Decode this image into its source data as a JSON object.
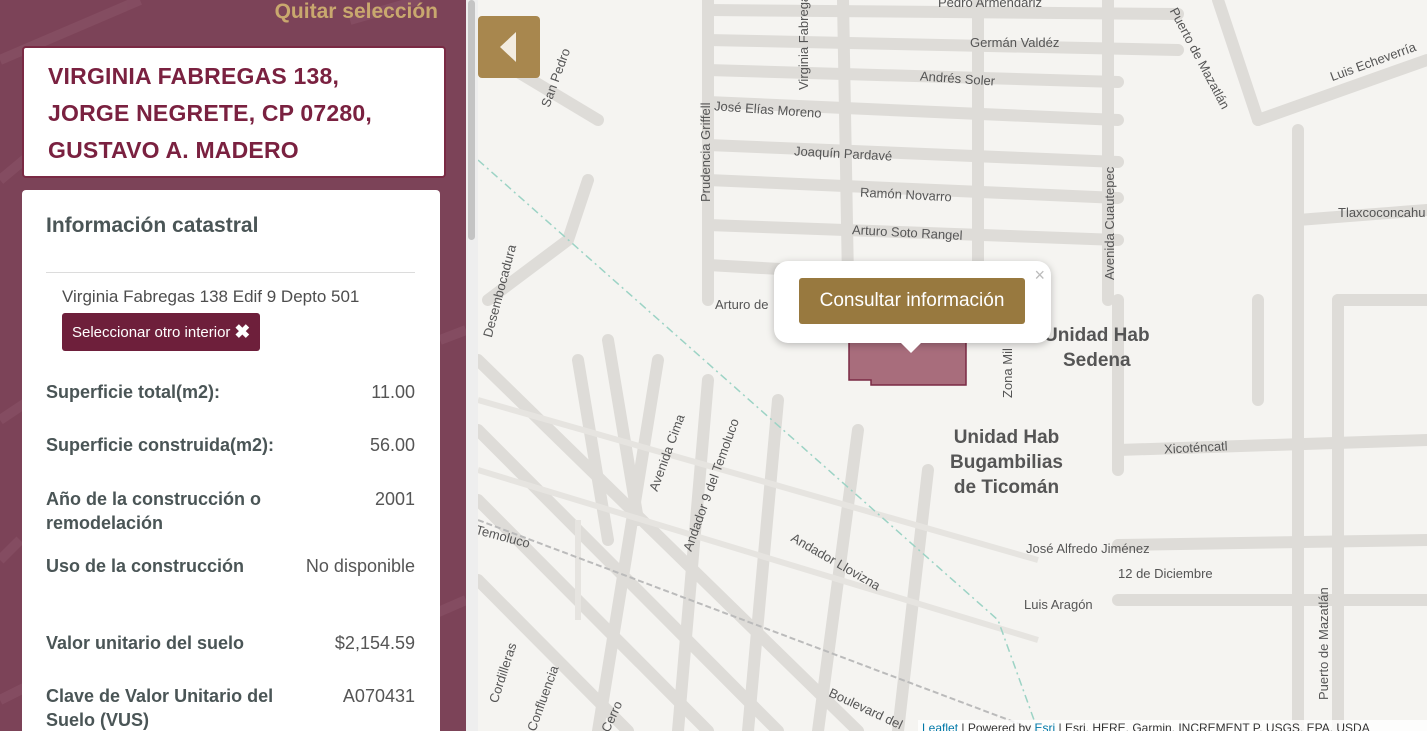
{
  "panel": {
    "remove_selection": "Quitar selección",
    "address_lines": [
      "VIRGINIA FABREGAS 138,",
      "JORGE NEGRETE, CP 07280,",
      "GUSTAVO A. MADERO"
    ],
    "info": {
      "title": "Información catastral",
      "interior": "Virginia Fabregas 138 Edif 9 Depto 501",
      "select_other_label": "Seleccionar otro interior",
      "rows": [
        {
          "label": "Superficie total(m2):",
          "value": "11.00"
        },
        {
          "label": "Superficie construida(m2):",
          "value": "56.00"
        },
        {
          "label": "Año de la construcción o remodelación",
          "value": "2001"
        },
        {
          "label": "Uso de la construcción",
          "value": "No disponible"
        },
        {
          "label": "Valor unitario del suelo",
          "value": "$2,154.59"
        },
        {
          "label": "Clave de Valor Unitario del Suelo (VUS)",
          "value": "A070431"
        }
      ]
    }
  },
  "map": {
    "popup": {
      "button_label": "Consultar información",
      "close": "×"
    },
    "streets": {
      "s1": "Pedro Armendáriz",
      "s2": "Germán Valdéz",
      "s3": "Andrés Soler",
      "s4": "José Elías Moreno",
      "s5": "Joaquín Pardavé",
      "s6": "Ramón Novarro",
      "s7": "Arturo Soto Rangel",
      "s8": "Arturo de",
      "s9": "Virginia Fabregas",
      "s10": "Prudencia Griffell",
      "s11": "San Pedro",
      "s12": "Puerto de Mazatlán",
      "s13": "Luis Echeverría",
      "s14": "Tlaxcoconcahu",
      "s15": "Avenida Cuautepec",
      "s16": "Zona Mil",
      "s17": "Xicoténcatl",
      "s18": "José Alfredo Jiménez",
      "s19": "12 de Diciembre",
      "s20": "Luis Aragón",
      "s21": "Avenida Cima",
      "s22": "Andador 9 del Temoluco",
      "s23": "Andador Llovizna",
      "s24": "Desembocadura",
      "s25": "Boulevard del",
      "s26": "Cordilleras",
      "s27": "Confluencia",
      "s28": "Cerro",
      "s29": "Puerto de Mazatlán",
      "s30": "Temoluco"
    },
    "zones": {
      "z1": "Unidad Hab\nSedena",
      "z2": "Unidad Hab\nBugambilias\nde Ticomán"
    },
    "attribution": {
      "leaflet": "Leaflet",
      "powered": " | Powered by ",
      "esri": "Esri",
      "rest": " | Esri, HERE, Garmin, INCREMENT P, USGS, EPA, USDA"
    }
  }
}
